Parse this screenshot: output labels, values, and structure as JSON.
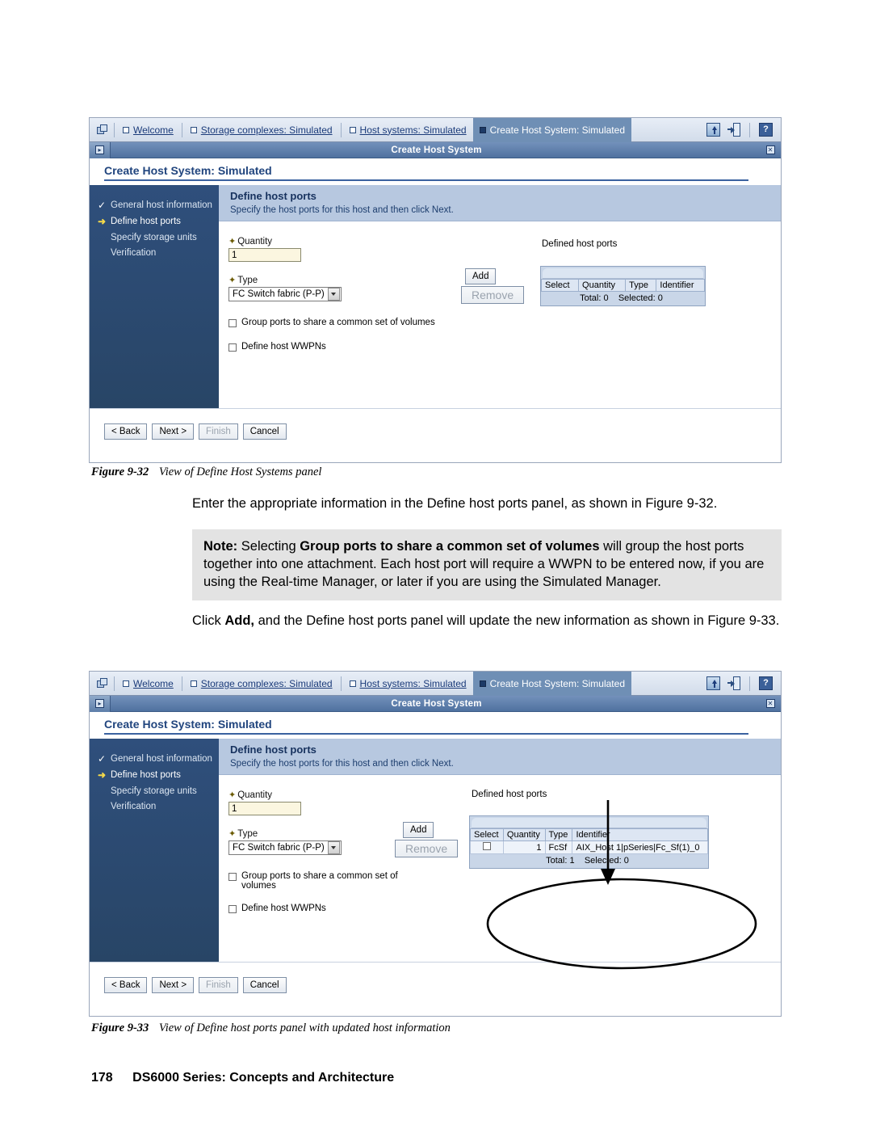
{
  "document": {
    "figure1_caption_num": "Figure 9-32",
    "figure1_caption_text": "View of Define Host Systems panel",
    "figure2_caption_num": "Figure 9-33",
    "figure2_caption_text": "View of Define host ports panel with updated host information",
    "para1": "Enter the appropriate information in the Define host ports panel, as shown in Figure 9-32.",
    "note": {
      "label": "Note:",
      "part1": " Selecting ",
      "bold1": "Group ports to share a common set of volumes",
      "part2": " will group the host ports together into one attachment. Each host port will require a WWPN to be entered now, if you are using the Real-time Manager, or later if you are using the Simulated Manager."
    },
    "para2": {
      "pre": "Click ",
      "bold": "Add,",
      "post": " and the Define host ports panel will update the new information as shown in Figure 9-33."
    },
    "footer_page": "178",
    "footer_book": "DS6000 Series: Concepts and Architecture"
  },
  "app": {
    "tabs": [
      {
        "label": "Welcome",
        "active": false
      },
      {
        "label": "Storage complexes: Simulated",
        "active": false
      },
      {
        "label": "Host systems: Simulated",
        "active": false
      },
      {
        "label": "Create Host System: Simulated",
        "active": true
      }
    ],
    "toolbar_icons": [
      "upload-icon",
      "exit-icon",
      "help-icon"
    ],
    "help_glyph": "?",
    "window_title": "Create Host System",
    "expand_glyph": "▸",
    "close_glyph": "✕",
    "panel_title": "Create Host System: Simulated",
    "wizard_steps": [
      {
        "marker": "✓",
        "label": "General host information",
        "state": "done"
      },
      {
        "marker": "➜",
        "label": "Define host ports",
        "state": "current"
      },
      {
        "marker": "",
        "label": "Specify storage units",
        "state": "pending"
      },
      {
        "marker": "",
        "label": "Verification",
        "state": "pending"
      }
    ],
    "step_title": "Define host ports",
    "step_subtitle": "Specify the host ports for this host and then click Next.",
    "quantity_label": "Quantity",
    "quantity_value": "1",
    "type_label": "Type",
    "type_value": "FC Switch fabric (P-P)",
    "checkbox_group_label": "Group ports to share a common set of volumes",
    "checkbox_group_label_l1": "Group ports to share a common set",
    "checkbox_group_label_l2": "of volumes",
    "checkbox_wwpn_label": "Define host WWPNs",
    "add_button": "Add",
    "remove_button": "Remove",
    "defined_label": "Defined host ports",
    "table_headers": [
      "Select",
      "Quantity",
      "Type",
      "Identifier"
    ],
    "nav_buttons": [
      {
        "label": "< Back",
        "enabled": true
      },
      {
        "label": "Next >",
        "enabled": true
      },
      {
        "label": "Finish",
        "enabled": false
      },
      {
        "label": "Cancel",
        "enabled": true
      }
    ]
  },
  "figure1_table": {
    "rows": [],
    "total_text": "Total: 0",
    "selected_text": "Selected: 0"
  },
  "figure2_table": {
    "rows": [
      {
        "select": "",
        "quantity": "1",
        "type": "FcSf",
        "identifier": "AIX_Host 1|pSeries|Fc_Sf(1)_0"
      }
    ],
    "total_text": "Total: 1",
    "selected_text": "Selected: 0"
  },
  "colors": {
    "tab_active": "#6f8fb5",
    "titlebar": "#4f719f",
    "sidebar": "#2f4f7c",
    "banner": "#b7c8e0",
    "heading_text": "#21457e",
    "input_bg": "#fbf6e0",
    "note_bg": "#e3e3e3"
  }
}
